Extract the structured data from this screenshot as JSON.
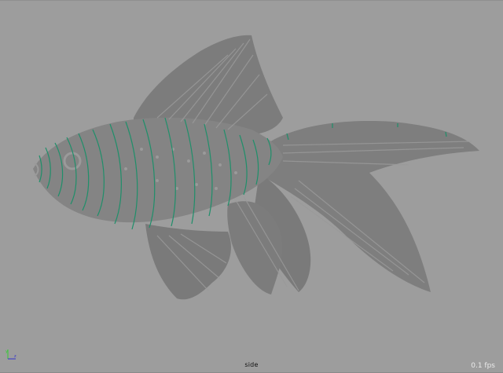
{
  "viewport": {
    "camera_name": "side",
    "fps_readout": "0.1 fps",
    "background_color": "#9d9d9d",
    "image_plane": {
      "subject": "goldfish-line-engraving",
      "tone_color": "#7d7d7d"
    },
    "curve_color": "#1f8f6a",
    "axis_gizmo": {
      "x_color": "#d33",
      "y_color": "#3c3",
      "z_color": "#33c"
    }
  }
}
